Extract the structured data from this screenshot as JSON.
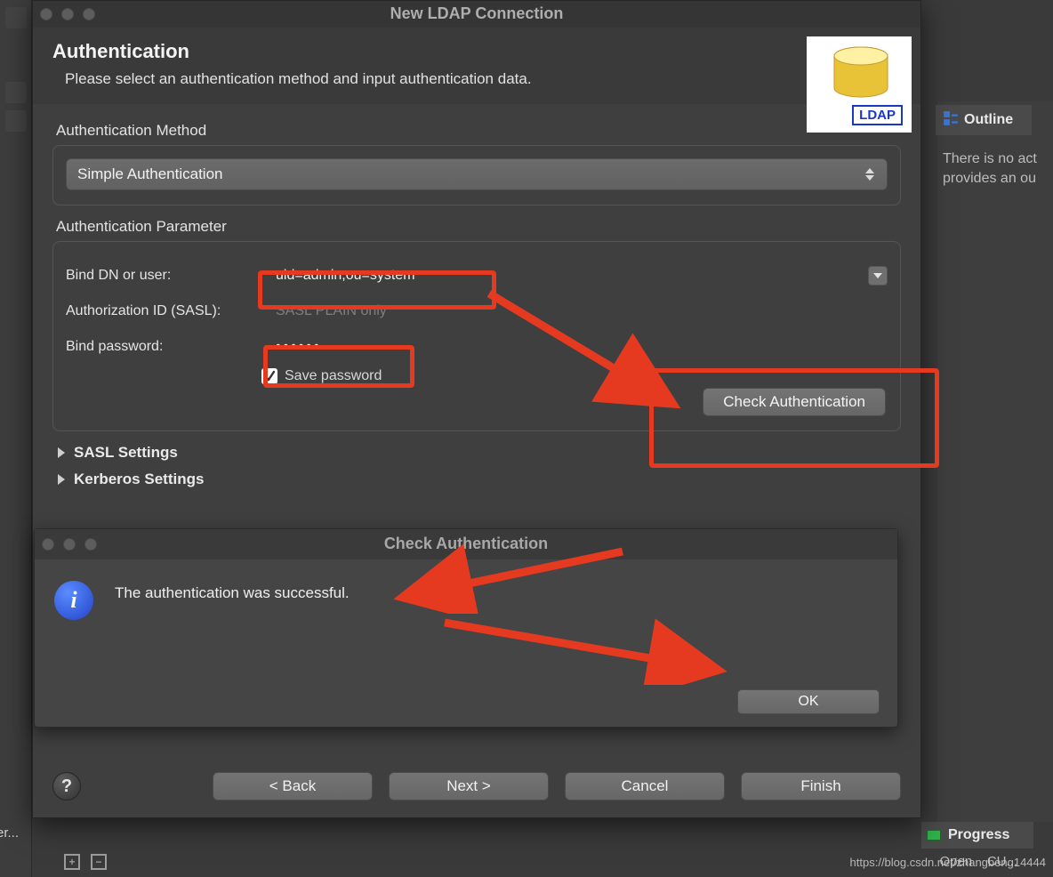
{
  "window": {
    "title": "New LDAP Connection"
  },
  "header": {
    "heading": "Authentication",
    "subtitle": "Please select an authentication method and input authentication data.",
    "badge_label": "LDAP"
  },
  "auth_method": {
    "section_label": "Authentication Method",
    "selected": "Simple Authentication"
  },
  "auth_param": {
    "section_label": "Authentication Parameter",
    "bind_dn_label": "Bind DN or user:",
    "bind_dn_value": "uid=admin,ou=system",
    "sasl_label": "Authorization ID (SASL):",
    "sasl_placeholder": "SASL PLAIN only",
    "password_label": "Bind password:",
    "password_masked": "••••••",
    "save_password_checked": true,
    "save_password_label": "Save password",
    "check_auth_label": "Check Authentication"
  },
  "expanders": {
    "sasl": "SASL Settings",
    "kerberos": "Kerberos Settings"
  },
  "info_dialog": {
    "title": "Check Authentication",
    "message": "The authentication was successful.",
    "ok_label": "OK"
  },
  "buttons": {
    "back": "< Back",
    "next": "Next >",
    "cancel": "Cancel",
    "finish": "Finish"
  },
  "right_panel": {
    "outline_tab": "Outline",
    "outline_msg_line1": "There is no act",
    "outline_msg_line2": "provides an ou",
    "progress_tab": "Progress"
  },
  "misc": {
    "er_label": "er...",
    "status_mid": "Open    CU...",
    "status_url": "https://blog.csdn.net/zhangbeng14444"
  }
}
